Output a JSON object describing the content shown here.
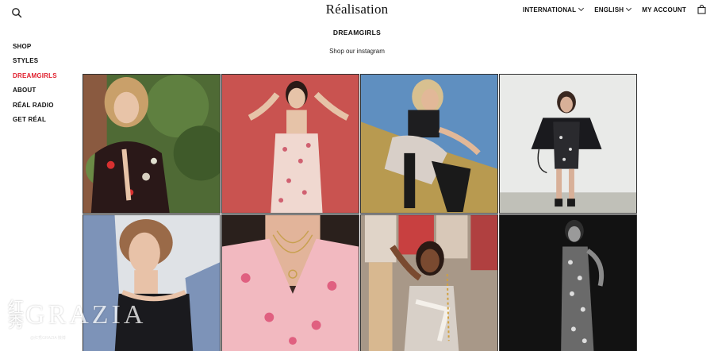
{
  "brand": {
    "logo_text": "Réalisation"
  },
  "top_nav": {
    "international": "INTERNATIONAL",
    "language": "ENGLISH",
    "account": "MY ACCOUNT"
  },
  "page": {
    "title": "DREAMGIRLS",
    "subtitle": "Shop our instagram"
  },
  "side_nav": {
    "items": [
      {
        "label": "SHOP"
      },
      {
        "label": "STYLES"
      },
      {
        "label": "DREAMGIRLS"
      },
      {
        "label": "ABOUT"
      },
      {
        "label": "RÉAL RADIO"
      },
      {
        "label": "GET RÉAL"
      }
    ]
  },
  "colors": {
    "active_nav": "#e0202e",
    "text": "#111111"
  },
  "watermark": {
    "cn": "红秀",
    "en": "GRAZIA",
    "small": "@红秀GRAZIA  微博"
  }
}
